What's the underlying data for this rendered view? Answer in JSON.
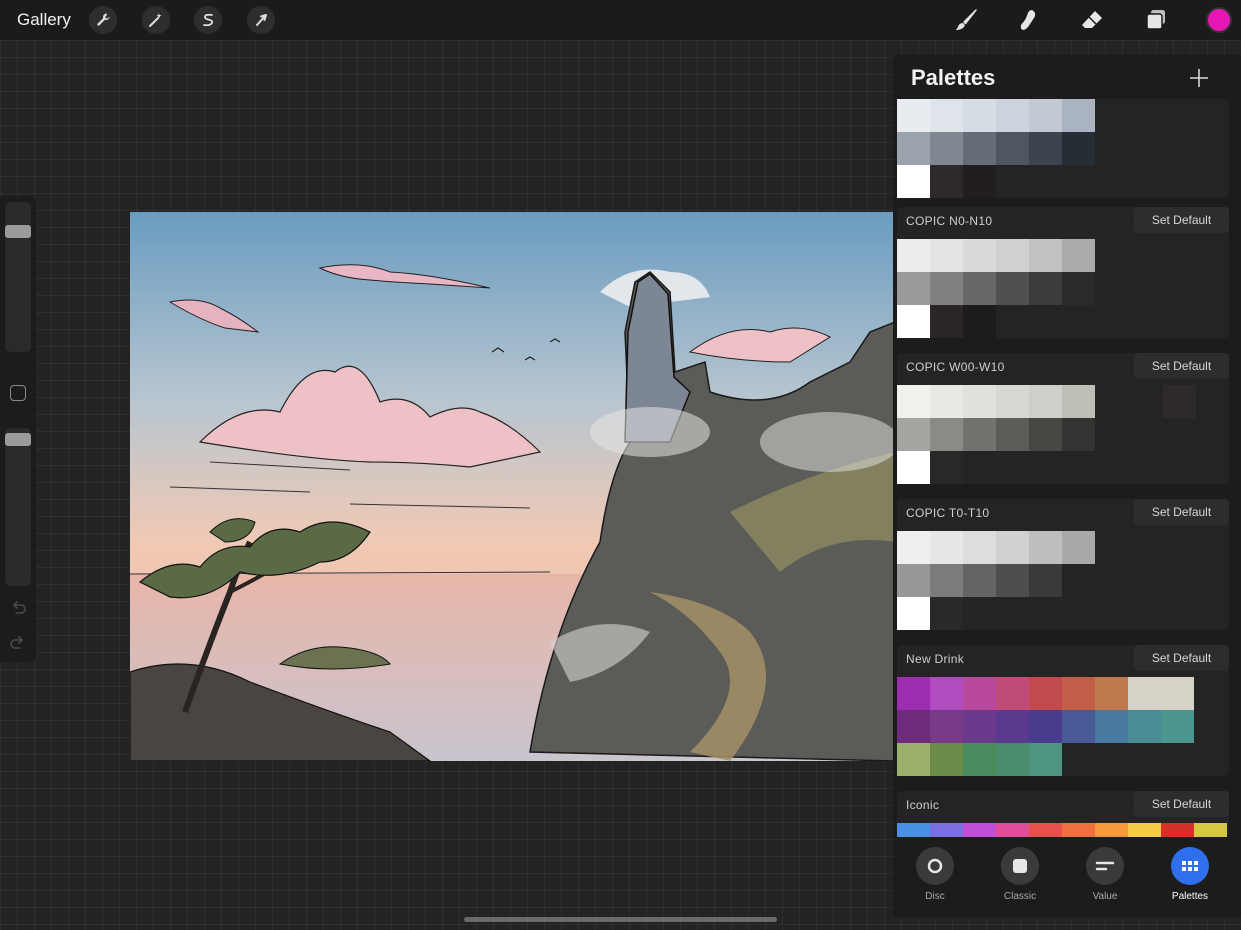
{
  "topbar": {
    "gallery_label": "Gallery",
    "active_color": "#e815b5"
  },
  "panel": {
    "title": "Palettes",
    "palettes": [
      {
        "name": "",
        "show_set_default": false,
        "rows": [
          [
            "#e8ecf0",
            "#dfe4ea",
            "#d6dce4",
            "#cdd3dc",
            "#c1c9d3",
            "#a9b4c0"
          ],
          [
            "#9aa2ab",
            "#7f8892",
            "#646d77",
            "#4e5660",
            "#3b434c",
            "#262d35"
          ],
          [
            "#ffffff",
            "#2e2a2a",
            "#221e1e"
          ]
        ]
      },
      {
        "name": "COPIC N0-N10",
        "set_default_label": "Set Default",
        "show_set_default": true,
        "rows": [
          [
            "#ececed",
            "#e3e3e5",
            "#dadadc",
            "#d0d0d2",
            "#c2c2c4",
            "#ababad"
          ],
          [
            "#9a9a9c",
            "#808082",
            "#676769",
            "#505052",
            "#3b3b3d",
            "#2a2a2c"
          ],
          [
            "#ffffff",
            "#2a2628",
            "#1e1b1c"
          ]
        ]
      },
      {
        "name": "COPIC W00-W10",
        "set_default_label": "Set Default",
        "show_set_default": true,
        "rows": [
          [
            "#f1f0ec",
            "#e9e8e3",
            "#e1e0db",
            "#d8d7d1",
            "#cfcec8",
            "#bebdb6"
          ],
          [
            "#a4a4a0",
            "#8a8a86",
            "#72726e",
            "#5c5c58",
            "#474744",
            "#333331"
          ],
          [
            "#ffffff",
            "#2a2727"
          ]
        ],
        "extra_swatch": "#2e2a2a"
      },
      {
        "name": "COPIC T0-T10",
        "set_default_label": "Set Default",
        "show_set_default": true,
        "rows": [
          [
            "#eeefef",
            "#e6e7e6",
            "#dddedc",
            "#d1d2cf",
            "#bebfbc",
            "#a9aaa7"
          ],
          [
            "#979896",
            "#7c7d7b",
            "#646563",
            "#4e4f4d",
            "#3a3b39"
          ],
          [
            "#ffffff",
            "#2a2828"
          ]
        ]
      },
      {
        "name": "New Drink",
        "set_default_label": "Set Default",
        "show_set_default": true,
        "rows": [
          [
            "#9c2cb0",
            "#b04cc0",
            "#b8489c",
            "#c04a78",
            "#c04a4e",
            "#c05e48",
            "#c0784e",
            "#d6d2c8",
            "#d6d2c8"
          ],
          [
            "#6e2a7c",
            "#7a3a8c",
            "#6a3a8c",
            "#5a3a8e",
            "#4a3c8c",
            "#4a5a96",
            "#4a7aa0",
            "#4a8c96",
            "#4e948e"
          ],
          [
            "#9ab06a",
            "#6a8c48",
            "#4a8c5e",
            "#4a8c6e",
            "#4e9480"
          ]
        ]
      },
      {
        "name": "Iconic",
        "set_default_label": "Set Default",
        "show_set_default": true,
        "rows": [
          [
            "#4a90e2",
            "#7a6ee2",
            "#c04ed6",
            "#e04e9a",
            "#e8504e",
            "#f07040",
            "#f59a3c",
            "#f5cc44",
            "#d63028",
            "#d6c840"
          ]
        ]
      }
    ]
  },
  "tabs": [
    {
      "label": "Disc",
      "active": false
    },
    {
      "label": "Classic",
      "active": false
    },
    {
      "label": "Value",
      "active": false
    },
    {
      "label": "Palettes",
      "active": true
    }
  ]
}
